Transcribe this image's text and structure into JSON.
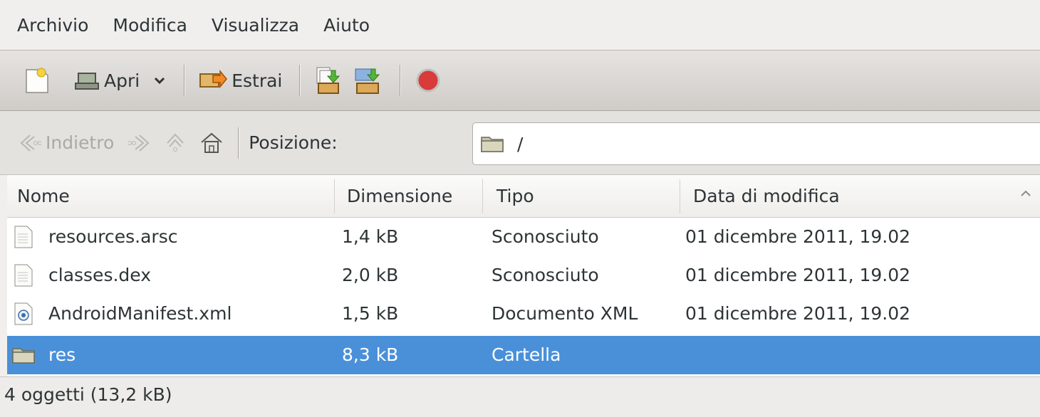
{
  "menubar": {
    "items": [
      "Archivio",
      "Modifica",
      "Visualizza",
      "Aiuto"
    ]
  },
  "toolbar": {
    "new_icon": "new-archive-icon",
    "open_label": "Apri",
    "extract_label": "Estrai",
    "stop_color": "#d93a3a"
  },
  "location": {
    "back_label": "Indietro",
    "position_label": "Posizione:",
    "path_value": "/"
  },
  "list": {
    "columns": [
      "Nome",
      "Dimensione",
      "Tipo",
      "Data di modifica"
    ],
    "rows": [
      {
        "name": "resources.arsc",
        "size": "1,4 kB",
        "type": "Sconosciuto",
        "date": "01 dicembre 2011, 19.02",
        "icon": "file-icon"
      },
      {
        "name": "classes.dex",
        "size": "2,0 kB",
        "type": "Sconosciuto",
        "date": "01 dicembre 2011, 19.02",
        "icon": "file-icon"
      },
      {
        "name": "AndroidManifest.xml",
        "size": "1,5 kB",
        "type": "Documento XML",
        "date": "01 dicembre 2011, 19.02",
        "icon": "xml-file-icon"
      },
      {
        "name": "res",
        "size": "8,3 kB",
        "type": "Cartella",
        "date": "",
        "icon": "folder-icon"
      }
    ],
    "selected_color": "#4a90d9"
  },
  "status": {
    "text": "4 oggetti (13,2 kB)"
  }
}
